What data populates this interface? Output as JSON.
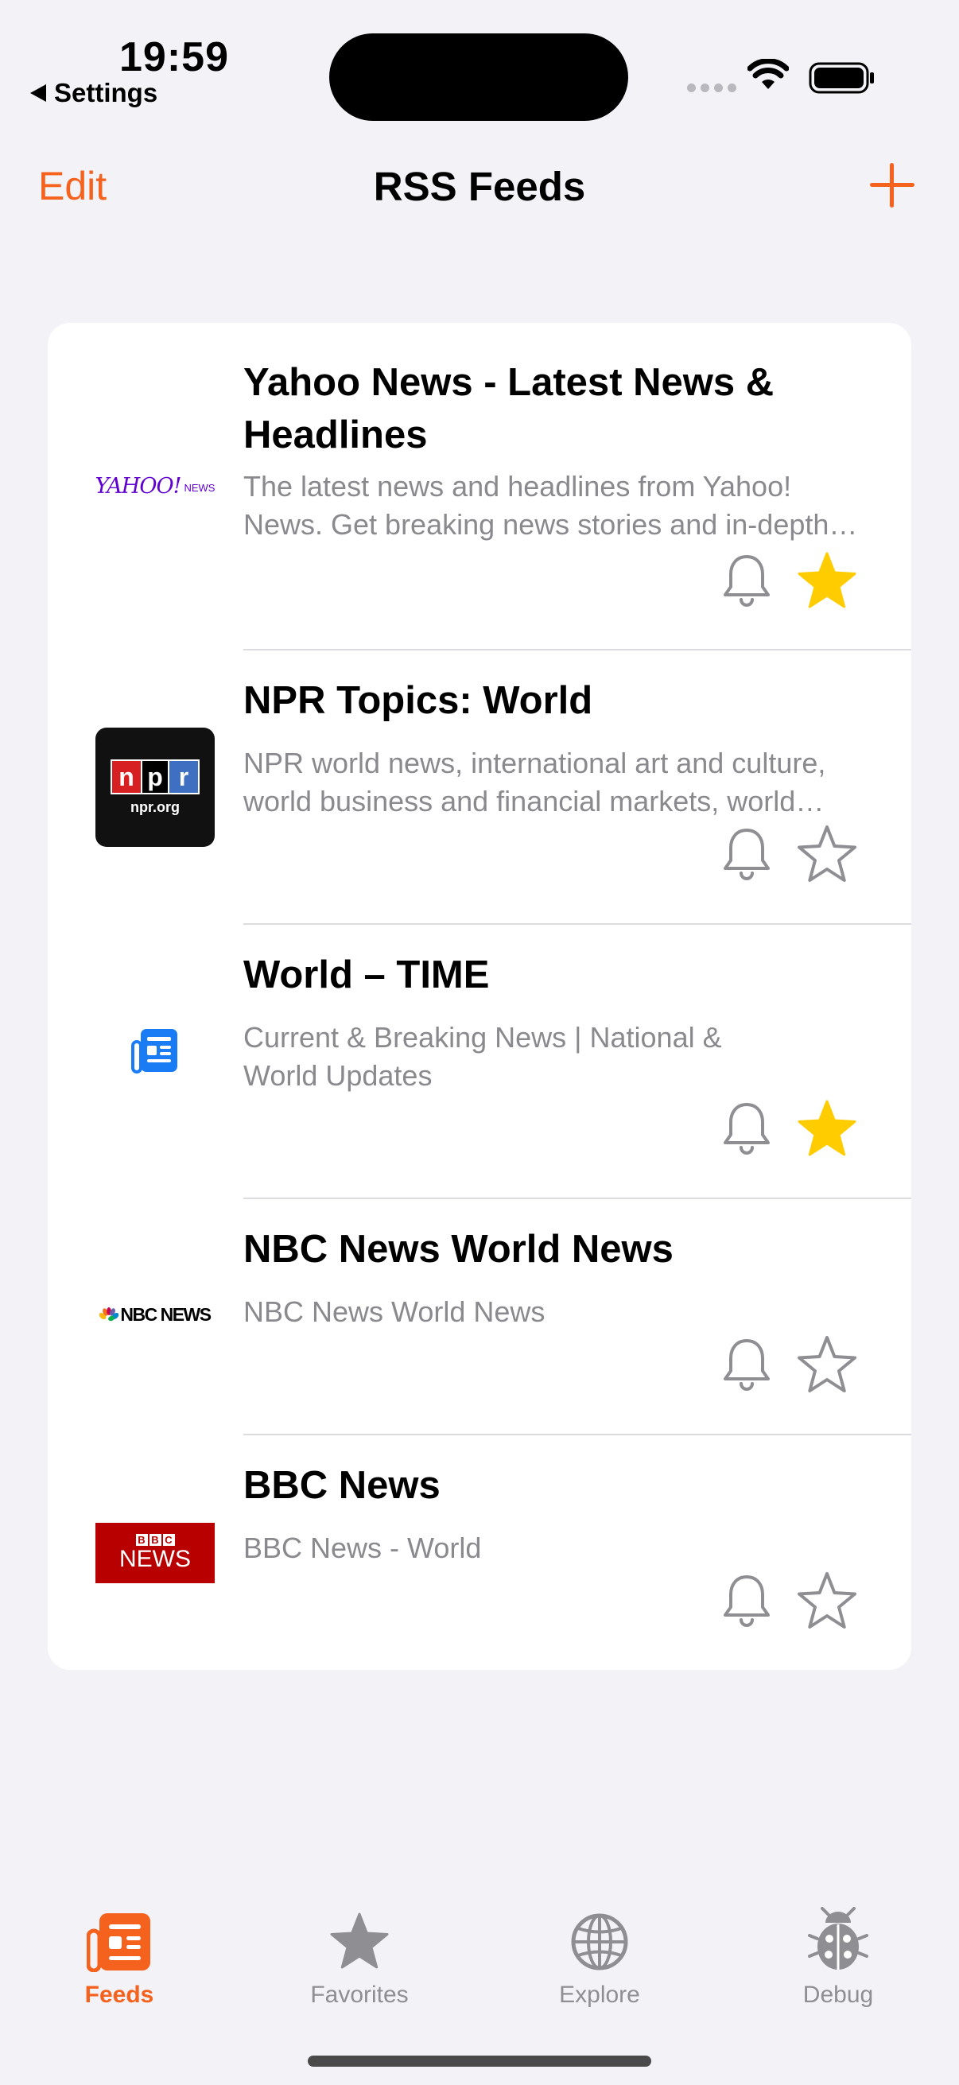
{
  "status_bar": {
    "time": "19:59",
    "back_app": "Settings"
  },
  "nav": {
    "edit_label": "Edit",
    "title": "RSS Feeds",
    "add_icon": "plus-icon"
  },
  "feeds": [
    {
      "title": "Yahoo News - Latest News & Headlines",
      "description": "The latest news and headlines from Yahoo! News. Get breaking news stories and in-depth coverage with videos and photos.",
      "logo": {
        "type": "yahoo",
        "text_main": "YAHOO!",
        "text_small": "NEWS",
        "color": "#6001d2"
      },
      "notifications": false,
      "favorite": true
    },
    {
      "title": "NPR Topics: World",
      "description": "NPR world news, international art and culture, world business and financial markets, world economy, and global trends.",
      "logo": {
        "type": "npr",
        "letters": [
          "n",
          "p",
          "r"
        ],
        "sub": "npr.org"
      },
      "notifications": false,
      "favorite": false
    },
    {
      "title": "World – TIME",
      "description": "Current & Breaking News | National & World Updates",
      "logo": {
        "type": "icon",
        "icon": "newspaper-icon",
        "color": "#1a7cf5"
      },
      "notifications": false,
      "favorite": true
    },
    {
      "title": "NBC News World News",
      "description": "NBC News World News",
      "logo": {
        "type": "nbc",
        "text": "NBC NEWS"
      },
      "notifications": false,
      "favorite": false
    },
    {
      "title": "BBC News",
      "description": "BBC News - World",
      "logo": {
        "type": "bbc",
        "letters": [
          "B",
          "B",
          "C"
        ],
        "text": "NEWS",
        "color": "#b80000"
      },
      "notifications": false,
      "favorite": false
    }
  ],
  "tabs": [
    {
      "label": "Feeds",
      "icon": "newspaper-icon",
      "active": true
    },
    {
      "label": "Favorites",
      "icon": "star-icon",
      "active": false
    },
    {
      "label": "Explore",
      "icon": "globe-icon",
      "active": false
    },
    {
      "label": "Debug",
      "icon": "ladybug-icon",
      "active": false
    }
  ],
  "colors": {
    "accent": "#f5621e",
    "favorite": "#ffcc00",
    "icon_gray": "#8e8e93",
    "background": "#f2f2f7"
  }
}
